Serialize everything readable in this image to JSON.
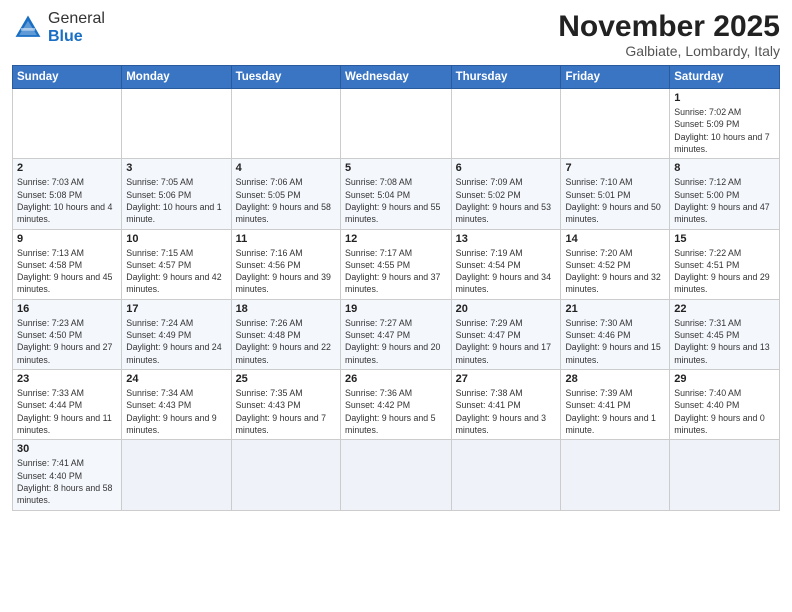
{
  "header": {
    "logo_general": "General",
    "logo_blue": "Blue",
    "month_title": "November 2025",
    "location": "Galbiate, Lombardy, Italy"
  },
  "weekdays": [
    "Sunday",
    "Monday",
    "Tuesday",
    "Wednesday",
    "Thursday",
    "Friday",
    "Saturday"
  ],
  "weeks": [
    [
      {
        "day": "",
        "info": ""
      },
      {
        "day": "",
        "info": ""
      },
      {
        "day": "",
        "info": ""
      },
      {
        "day": "",
        "info": ""
      },
      {
        "day": "",
        "info": ""
      },
      {
        "day": "",
        "info": ""
      },
      {
        "day": "1",
        "info": "Sunrise: 7:02 AM\nSunset: 5:09 PM\nDaylight: 10 hours and 7 minutes."
      }
    ],
    [
      {
        "day": "2",
        "info": "Sunrise: 7:03 AM\nSunset: 5:08 PM\nDaylight: 10 hours and 4 minutes."
      },
      {
        "day": "3",
        "info": "Sunrise: 7:05 AM\nSunset: 5:06 PM\nDaylight: 10 hours and 1 minute."
      },
      {
        "day": "4",
        "info": "Sunrise: 7:06 AM\nSunset: 5:05 PM\nDaylight: 9 hours and 58 minutes."
      },
      {
        "day": "5",
        "info": "Sunrise: 7:08 AM\nSunset: 5:04 PM\nDaylight: 9 hours and 55 minutes."
      },
      {
        "day": "6",
        "info": "Sunrise: 7:09 AM\nSunset: 5:02 PM\nDaylight: 9 hours and 53 minutes."
      },
      {
        "day": "7",
        "info": "Sunrise: 7:10 AM\nSunset: 5:01 PM\nDaylight: 9 hours and 50 minutes."
      },
      {
        "day": "8",
        "info": "Sunrise: 7:12 AM\nSunset: 5:00 PM\nDaylight: 9 hours and 47 minutes."
      }
    ],
    [
      {
        "day": "9",
        "info": "Sunrise: 7:13 AM\nSunset: 4:58 PM\nDaylight: 9 hours and 45 minutes."
      },
      {
        "day": "10",
        "info": "Sunrise: 7:15 AM\nSunset: 4:57 PM\nDaylight: 9 hours and 42 minutes."
      },
      {
        "day": "11",
        "info": "Sunrise: 7:16 AM\nSunset: 4:56 PM\nDaylight: 9 hours and 39 minutes."
      },
      {
        "day": "12",
        "info": "Sunrise: 7:17 AM\nSunset: 4:55 PM\nDaylight: 9 hours and 37 minutes."
      },
      {
        "day": "13",
        "info": "Sunrise: 7:19 AM\nSunset: 4:54 PM\nDaylight: 9 hours and 34 minutes."
      },
      {
        "day": "14",
        "info": "Sunrise: 7:20 AM\nSunset: 4:52 PM\nDaylight: 9 hours and 32 minutes."
      },
      {
        "day": "15",
        "info": "Sunrise: 7:22 AM\nSunset: 4:51 PM\nDaylight: 9 hours and 29 minutes."
      }
    ],
    [
      {
        "day": "16",
        "info": "Sunrise: 7:23 AM\nSunset: 4:50 PM\nDaylight: 9 hours and 27 minutes."
      },
      {
        "day": "17",
        "info": "Sunrise: 7:24 AM\nSunset: 4:49 PM\nDaylight: 9 hours and 24 minutes."
      },
      {
        "day": "18",
        "info": "Sunrise: 7:26 AM\nSunset: 4:48 PM\nDaylight: 9 hours and 22 minutes."
      },
      {
        "day": "19",
        "info": "Sunrise: 7:27 AM\nSunset: 4:47 PM\nDaylight: 9 hours and 20 minutes."
      },
      {
        "day": "20",
        "info": "Sunrise: 7:29 AM\nSunset: 4:47 PM\nDaylight: 9 hours and 17 minutes."
      },
      {
        "day": "21",
        "info": "Sunrise: 7:30 AM\nSunset: 4:46 PM\nDaylight: 9 hours and 15 minutes."
      },
      {
        "day": "22",
        "info": "Sunrise: 7:31 AM\nSunset: 4:45 PM\nDaylight: 9 hours and 13 minutes."
      }
    ],
    [
      {
        "day": "23",
        "info": "Sunrise: 7:33 AM\nSunset: 4:44 PM\nDaylight: 9 hours and 11 minutes."
      },
      {
        "day": "24",
        "info": "Sunrise: 7:34 AM\nSunset: 4:43 PM\nDaylight: 9 hours and 9 minutes."
      },
      {
        "day": "25",
        "info": "Sunrise: 7:35 AM\nSunset: 4:43 PM\nDaylight: 9 hours and 7 minutes."
      },
      {
        "day": "26",
        "info": "Sunrise: 7:36 AM\nSunset: 4:42 PM\nDaylight: 9 hours and 5 minutes."
      },
      {
        "day": "27",
        "info": "Sunrise: 7:38 AM\nSunset: 4:41 PM\nDaylight: 9 hours and 3 minutes."
      },
      {
        "day": "28",
        "info": "Sunrise: 7:39 AM\nSunset: 4:41 PM\nDaylight: 9 hours and 1 minute."
      },
      {
        "day": "29",
        "info": "Sunrise: 7:40 AM\nSunset: 4:40 PM\nDaylight: 9 hours and 0 minutes."
      }
    ],
    [
      {
        "day": "30",
        "info": "Sunrise: 7:41 AM\nSunset: 4:40 PM\nDaylight: 8 hours and 58 minutes."
      },
      {
        "day": "",
        "info": ""
      },
      {
        "day": "",
        "info": ""
      },
      {
        "day": "",
        "info": ""
      },
      {
        "day": "",
        "info": ""
      },
      {
        "day": "",
        "info": ""
      },
      {
        "day": "",
        "info": ""
      }
    ]
  ]
}
